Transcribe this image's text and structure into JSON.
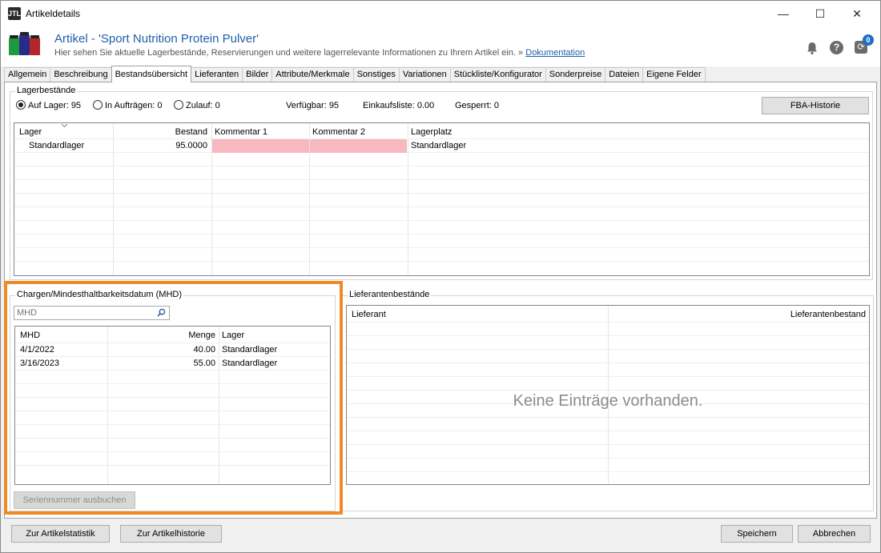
{
  "window": {
    "title": "Artikeldetails",
    "logo_text": "JTL",
    "controls": {
      "minimize": "—",
      "maximize": "☐",
      "close": "✕"
    }
  },
  "header": {
    "title": "Artikel - 'Sport Nutrition Protein Pulver'",
    "subtitle": "Hier sehen Sie aktuelle Lagerbestände, Reservierungen und weitere lagerrelevante Informationen zu Ihrem Artikel ein. »",
    "doc_link": "Dokumentation",
    "icons": [
      "bell-icon",
      "help-icon",
      "sync-icon"
    ],
    "badge": "0"
  },
  "tabs": [
    {
      "label": "Allgemein",
      "active": false
    },
    {
      "label": "Beschreibung",
      "active": false
    },
    {
      "label": "Bestandsübersicht",
      "active": true
    },
    {
      "label": "Lieferanten",
      "active": false
    },
    {
      "label": "Bilder",
      "active": false
    },
    {
      "label": "Attribute/Merkmale",
      "active": false
    },
    {
      "label": "Sonstiges",
      "active": false
    },
    {
      "label": "Variationen",
      "active": false
    },
    {
      "label": "Stückliste/Konfigurator",
      "active": false
    },
    {
      "label": "Sonderpreise",
      "active": false
    },
    {
      "label": "Dateien",
      "active": false
    },
    {
      "label": "Eigene Felder",
      "active": false
    }
  ],
  "lager": {
    "title": "Lagerbestände",
    "radios": {
      "auf_lager": "Auf Lager: 95",
      "in_auftraegen": "In Aufträgen: 0",
      "zulauf": "Zulauf: 0"
    },
    "stats": {
      "verfuegbar": "Verfügbar: 95",
      "einkaufsliste": "Einkaufsliste: 0.00",
      "gesperrt": "Gesperrt: 0"
    },
    "fba_button": "FBA-Historie",
    "columns": {
      "lager": "Lager",
      "bestand": "Bestand",
      "kommentar1": "Kommentar 1",
      "kommentar2": "Kommentar 2",
      "lagerplatz": "Lagerplatz"
    },
    "rows": [
      {
        "lager": "Standardlager",
        "bestand": "95.0000",
        "kommentar1": "",
        "kommentar2": "",
        "lagerplatz": "Standardlager"
      }
    ]
  },
  "mhd": {
    "title": "Chargen/Mindesthaltbarkeitsdatum (MHD)",
    "search_placeholder": "MHD",
    "columns": {
      "mhd": "MHD",
      "menge": "Menge",
      "lager": "Lager"
    },
    "rows": [
      {
        "mhd": "4/1/2022",
        "menge": "40.00",
        "lager": "Standardlager"
      },
      {
        "mhd": "3/16/2023",
        "menge": "55.00",
        "lager": "Standardlager"
      }
    ],
    "button": "Seriennummer ausbuchen"
  },
  "lieferanten": {
    "title": "Lieferantenbestände",
    "columns": {
      "lieferant": "Lieferant",
      "bestand": "Lieferantenbestand"
    },
    "empty": "Keine Einträge vorhanden."
  },
  "footer": {
    "statistik": "Zur Artikelstatistik",
    "historie": "Zur Artikelhistorie",
    "speichern": "Speichern",
    "abbrechen": "Abbrechen"
  },
  "colors": {
    "accent": "#1f5fa8",
    "highlight": "#f08a24",
    "empty_comment": "#f7b8c0"
  }
}
